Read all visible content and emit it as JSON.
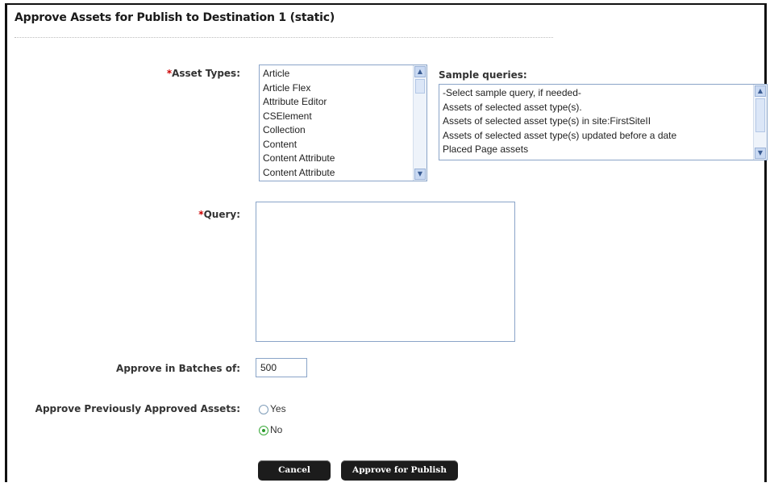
{
  "page": {
    "title": "Approve Assets for Publish to Destination 1 (static)"
  },
  "form": {
    "asset_types": {
      "required_mark": "*",
      "label": "Asset Types:",
      "items": [
        "Article",
        "Article Flex",
        "Attribute Editor",
        "CSElement",
        "Collection",
        "Content",
        "Content Attribute",
        "Content Attribute"
      ]
    },
    "sample_queries": {
      "label": "Sample queries:",
      "items": [
        "-Select sample query, if needed-",
        "Assets of selected asset type(s).",
        "Assets of selected asset type(s) in site:FirstSiteII",
        "Assets of selected asset type(s) updated before a date",
        "Placed Page assets"
      ]
    },
    "query": {
      "required_mark": "*",
      "label": "Query:",
      "value": ""
    },
    "batch": {
      "label": "Approve in Batches of:",
      "value": "500"
    },
    "previously_approved": {
      "label": "Approve Previously Approved Assets:",
      "options": [
        {
          "label": "Yes",
          "checked": false
        },
        {
          "label": "No",
          "checked": true
        }
      ]
    }
  },
  "buttons": {
    "cancel": "Cancel",
    "approve": "Approve for Publish"
  },
  "colors": {
    "required": "#cc0000",
    "button_bg": "#1c1c1c",
    "field_border": "#8aa4c8"
  }
}
